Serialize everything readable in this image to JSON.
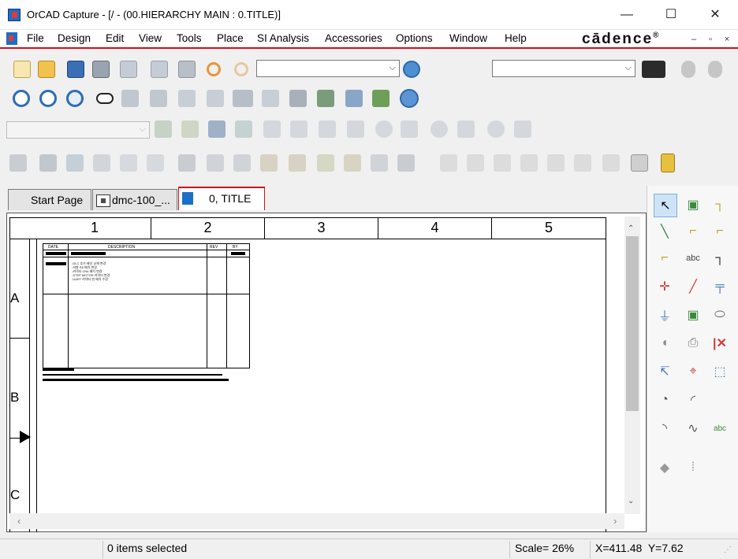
{
  "window": {
    "title": "OrCAD Capture - [/ - (00.HIERARCHY MAIN : 0.TITLE)]",
    "minimize": "—",
    "maximize": "☐",
    "close": "✕"
  },
  "menu": {
    "items": [
      "File",
      "Design",
      "Edit",
      "View",
      "Tools",
      "Place",
      "SI Analysis",
      "Accessories",
      "Options",
      "Window",
      "Help"
    ],
    "brand": "cādence",
    "brand_mark": "®",
    "mdi_min": "–",
    "mdi_restore": "▫",
    "mdi_close": "×"
  },
  "toolbar": {
    "part_combo_value": "",
    "search_combo_value": "",
    "net_combo_value": ""
  },
  "tabs": [
    {
      "label": "Start Page"
    },
    {
      "label": "dmc-100_..."
    },
    {
      "label": "0, TITLE"
    }
  ],
  "schematic": {
    "columns": [
      "1",
      "2",
      "3",
      "4",
      "5"
    ],
    "rows": [
      "A",
      "B",
      "C"
    ],
    "revision_block": {
      "headers": [
        "DATE",
        "DESCRIPTION",
        "REV",
        "BY"
      ],
      "notes": [
        "-DLC 추가 배선 교체 변경",
        "-저항 R5 배치 변경",
        "-커넥터 CN4 배치 변경",
        "-STEP MOTOR 커넥터 변경",
        "-UART 커넥터 핀 배치 수정"
      ]
    }
  },
  "status": {
    "selection": "0 items selected",
    "scale": "Scale= 26%",
    "coords": "X=411.48  Y=7.62"
  }
}
